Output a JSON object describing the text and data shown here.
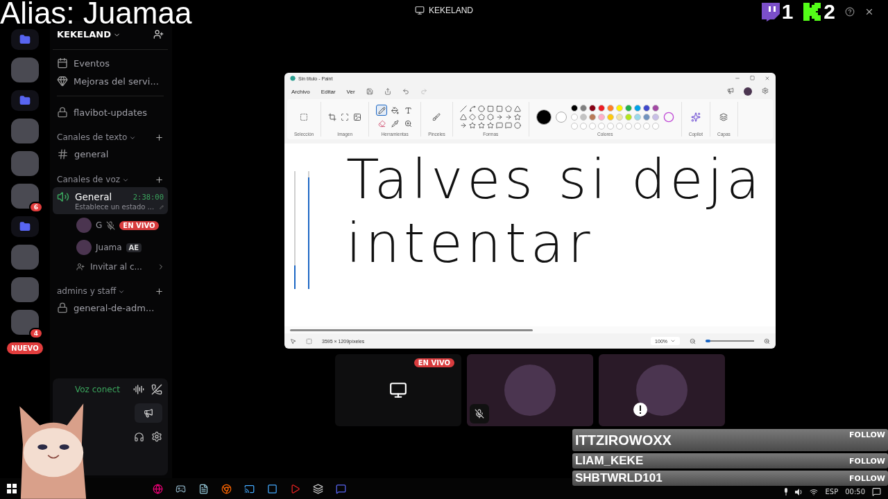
{
  "stream_overlay": {
    "alias": "Alias: Juamaa"
  },
  "titlebar": {
    "title": "KEKELAND"
  },
  "counters": [
    {
      "kind": "twitch",
      "value": "1"
    },
    {
      "kind": "kick",
      "value": "2"
    }
  ],
  "server_rail": {
    "items": [
      {
        "kind": "folder"
      },
      {
        "kind": "server"
      },
      {
        "kind": "folder"
      },
      {
        "kind": "server"
      },
      {
        "kind": "server"
      },
      {
        "kind": "server",
        "badge": "6"
      },
      {
        "kind": "folder"
      },
      {
        "kind": "server"
      },
      {
        "kind": "server"
      },
      {
        "kind": "server",
        "badge": "4"
      }
    ],
    "new_badge": "NUEVO"
  },
  "server_name": "KEKELAND",
  "pinned": [
    {
      "kind": "events",
      "label": "Eventos"
    },
    {
      "kind": "boosts",
      "label": "Mejoras del servi..."
    }
  ],
  "sections": [
    {
      "kind": "plain",
      "channels": [
        {
          "kind": "locked",
          "name": "flavibot-updates"
        }
      ]
    },
    {
      "kind": "category",
      "title": "Canales de texto",
      "channels": [
        {
          "kind": "text",
          "name": "general"
        }
      ]
    },
    {
      "kind": "category",
      "title": "Canales de voz",
      "channels": [
        {
          "kind": "voice",
          "name": "General",
          "selected": true,
          "timer": "2:38:00",
          "status": "Establece un estado ...",
          "members": [
            {
              "name": "G",
              "muted": true,
              "live": "EN VIVO"
            },
            {
              "name": "Juama",
              "muted": false,
              "tag": "AE"
            }
          ],
          "invite": "Invitar al c..."
        }
      ]
    },
    {
      "kind": "category",
      "title": "admins y staff",
      "channels": [
        {
          "kind": "locked",
          "name": "general-de-adm..."
        }
      ]
    }
  ],
  "voice_panel": {
    "status": "Voz conect"
  },
  "paint": {
    "title": "Sin título - Paint",
    "menus": [
      "Archivo",
      "Editar",
      "Ver"
    ],
    "groups": [
      {
        "kind": "selection",
        "label": "Selección"
      },
      {
        "kind": "image",
        "label": "Imagen"
      },
      {
        "kind": "tools",
        "label": "Herramientas"
      },
      {
        "kind": "brushes",
        "label": "Pinceles"
      },
      {
        "kind": "shapes",
        "label": "Formas"
      },
      {
        "kind": "colors",
        "label": "Colores"
      },
      {
        "kind": "copilot",
        "label": "Copilot"
      },
      {
        "kind": "layers",
        "label": "Capas"
      }
    ],
    "tools": [
      {
        "kind": "pencil",
        "selected": true
      },
      {
        "kind": "fill",
        "selected": false
      },
      {
        "kind": "text",
        "selected": false
      },
      {
        "kind": "eraser",
        "selected": false
      },
      {
        "kind": "picker",
        "selected": false
      },
      {
        "kind": "magnifier",
        "selected": false
      }
    ],
    "current_colors": [
      {
        "color": "#000000"
      },
      {
        "color": "#ffffff"
      }
    ],
    "palette": [
      {
        "color": "#000000"
      },
      {
        "color": "#7f7f7f"
      },
      {
        "color": "#880015"
      },
      {
        "color": "#ed1c24"
      },
      {
        "color": "#ff7f27"
      },
      {
        "color": "#fff200"
      },
      {
        "color": "#22b14c"
      },
      {
        "color": "#00a2e8"
      },
      {
        "color": "#3f48cc"
      },
      {
        "color": "#a349a4"
      },
      {
        "color": "#ffffff"
      },
      {
        "color": "#c3c3c3"
      },
      {
        "color": "#b97a57"
      },
      {
        "color": "#ffaec9"
      },
      {
        "color": "#ffc90e"
      },
      {
        "color": "#efe4b0"
      },
      {
        "color": "#b5e61d"
      },
      {
        "color": "#99d9ea"
      },
      {
        "color": "#7092be"
      },
      {
        "color": "#c8bfe7"
      }
    ],
    "sliders": [
      {
        "level": 0.2
      },
      {
        "level": 0.95
      }
    ],
    "drawing_lines": [
      "Talves si deja",
      "intentar"
    ],
    "canvas_size": "3595 × 1209píxeles",
    "zoom": "100%",
    "zoom_slider": {
      "level": 0.1
    }
  },
  "tiles": [
    {
      "kind": "screen",
      "badge": "EN VIVO"
    },
    {
      "kind": "avatar",
      "muted": true,
      "alert": false
    },
    {
      "kind": "avatar",
      "muted": false,
      "alert": true
    }
  ],
  "follows": [
    {
      "name": "ITTZIROWOXX",
      "action": "FOLLOW",
      "highlighted": true
    },
    {
      "name": "LIAM_KEKE",
      "action": "FOLLOW",
      "highlighted": false
    },
    {
      "name": "SHBTWRLD101",
      "action": "FOLLOW",
      "highlighted": false
    }
  ],
  "taskbar": {
    "language": "ESP",
    "time": "00:50"
  }
}
